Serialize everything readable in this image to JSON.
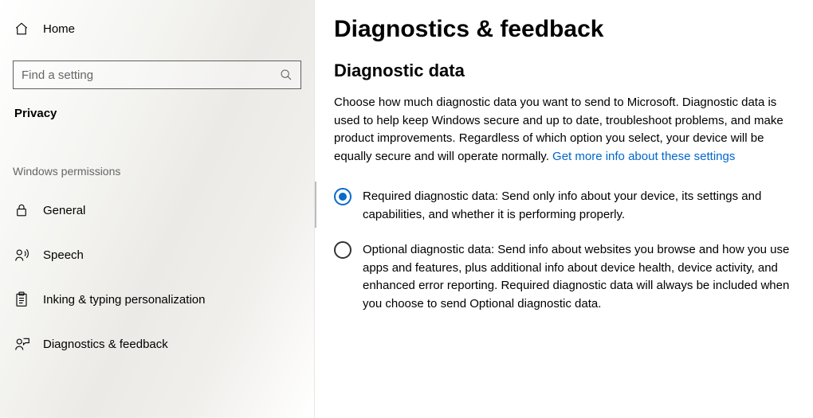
{
  "sidebar": {
    "home_label": "Home",
    "search_placeholder": "Find a setting",
    "category_title": "Privacy",
    "subheader": "Windows permissions",
    "items": [
      {
        "label": "General"
      },
      {
        "label": "Speech"
      },
      {
        "label": "Inking & typing personalization"
      },
      {
        "label": "Diagnostics & feedback"
      }
    ]
  },
  "main": {
    "page_title": "Diagnostics & feedback",
    "section_title": "Diagnostic data",
    "section_desc": "Choose how much diagnostic data you want to send to Microsoft. Diagnostic data is used to help keep Windows secure and up to date, troubleshoot problems, and make product improvements. Regardless of which option you select, your device will be equally secure and will operate normally. ",
    "link_text": "Get more info about these settings",
    "options": [
      {
        "label": "Required diagnostic data: Send only info about your device, its settings and capabilities, and whether it is performing properly.",
        "selected": true
      },
      {
        "label": "Optional diagnostic data: Send info about websites you browse and how you use apps and features, plus additional info about device health, device activity, and enhanced error reporting. Required diagnostic data will always be included when you choose to send Optional diagnostic data.",
        "selected": false
      }
    ]
  }
}
